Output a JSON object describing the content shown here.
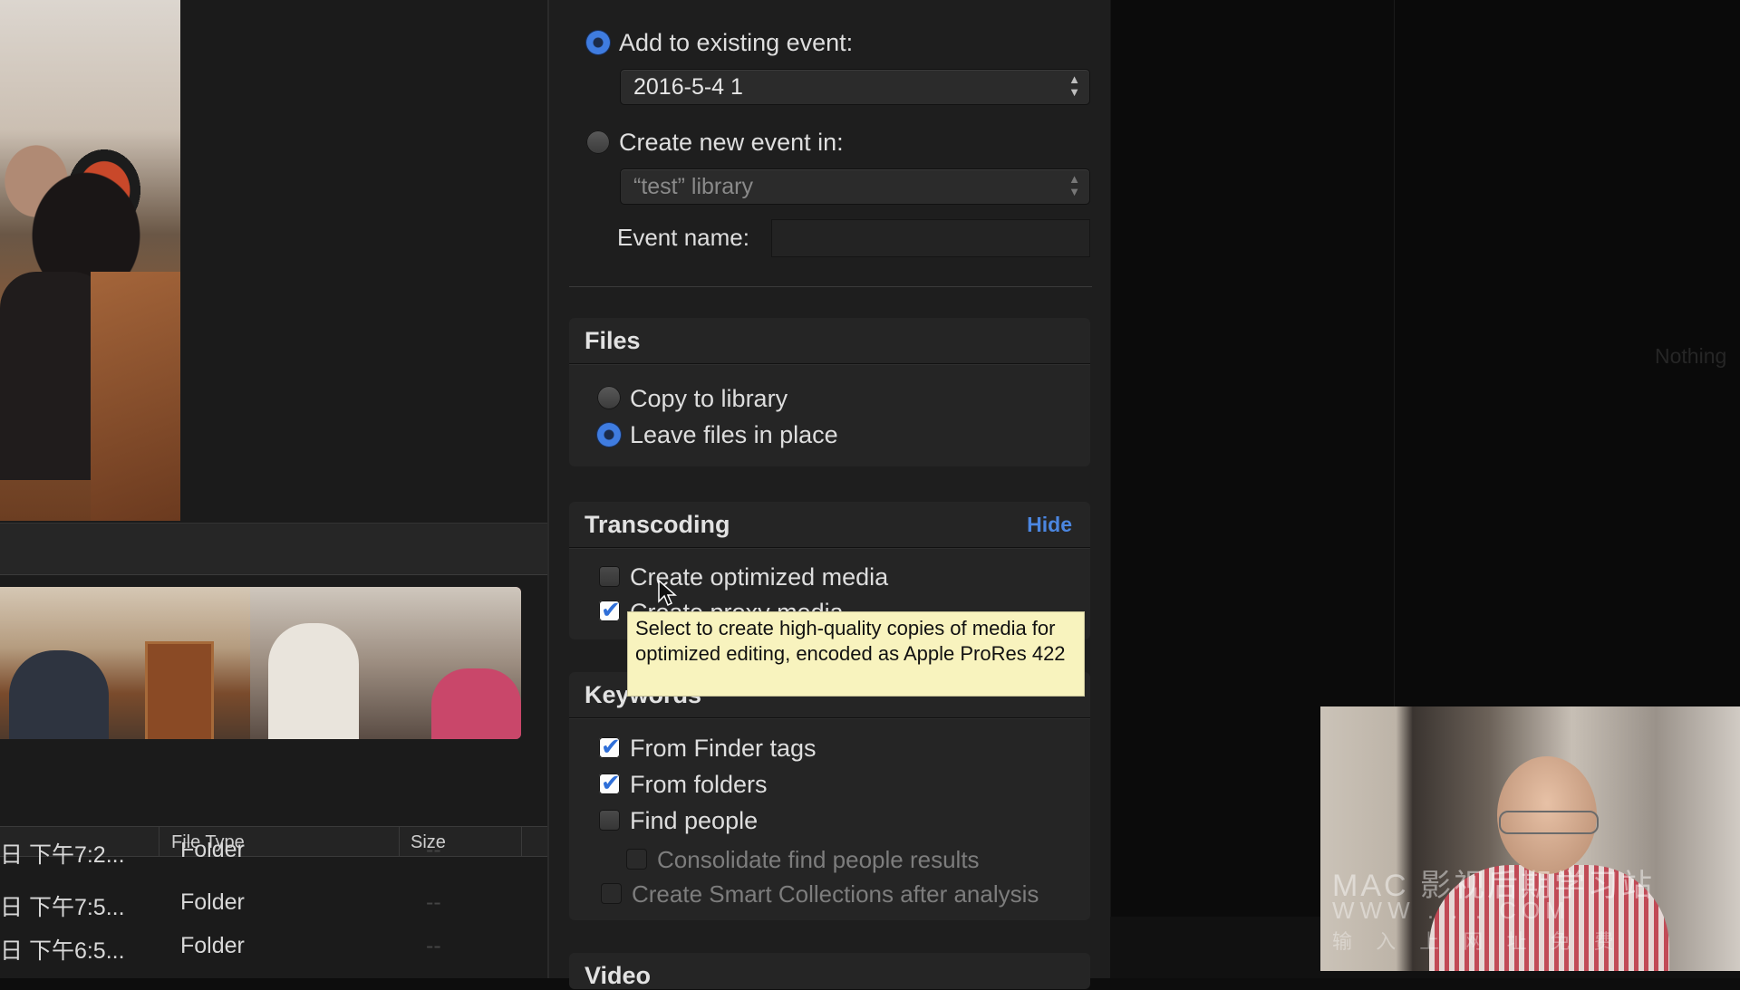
{
  "event_options": {
    "add_existing_label": "Add to existing event:",
    "existing_event_value": "2016-5-4 1",
    "create_new_label": "Create new event in:",
    "library_value": "“test” library",
    "event_name_label": "Event name:",
    "event_name_value": ""
  },
  "files": {
    "title": "Files",
    "copy_label": "Copy to library",
    "leave_label": "Leave files in place"
  },
  "transcoding": {
    "title": "Transcoding",
    "hide_label": "Hide",
    "optimized_label": "Create optimized media",
    "proxy_label": "Create proxy media"
  },
  "tooltip_text": "Select to create high-quality copies of media for optimized editing, encoded as Apple ProRes 422",
  "keywords": {
    "title": "Keywords",
    "finder_tags_label": "From Finder tags",
    "folders_label": "From folders",
    "find_people_label": "Find people",
    "consolidate_label": "Consolidate find people results",
    "smart_collections_label": "Create Smart Collections after analysis"
  },
  "video": {
    "title": "Video"
  },
  "file_table": {
    "headers": [
      "File Type",
      "Size"
    ],
    "rows": [
      {
        "date": "日 下午7:2...",
        "type": "Folder",
        "size": "--"
      },
      {
        "date": "日 下午7:5...",
        "type": "Folder",
        "size": "--"
      },
      {
        "date": "日 下午6:5...",
        "type": "Folder",
        "size": "--"
      }
    ]
  },
  "inspector": {
    "empty_text": "Nothing"
  },
  "watermark": {
    "line1": "MAC 影视后期学习站",
    "line2": "WWW . . . COM",
    "line3": "输 入 上 网 址 免 费"
  },
  "colors": {
    "accent": "#3f7ce0",
    "tooltip_bg": "#f8f3be",
    "link": "#4b86e0"
  }
}
